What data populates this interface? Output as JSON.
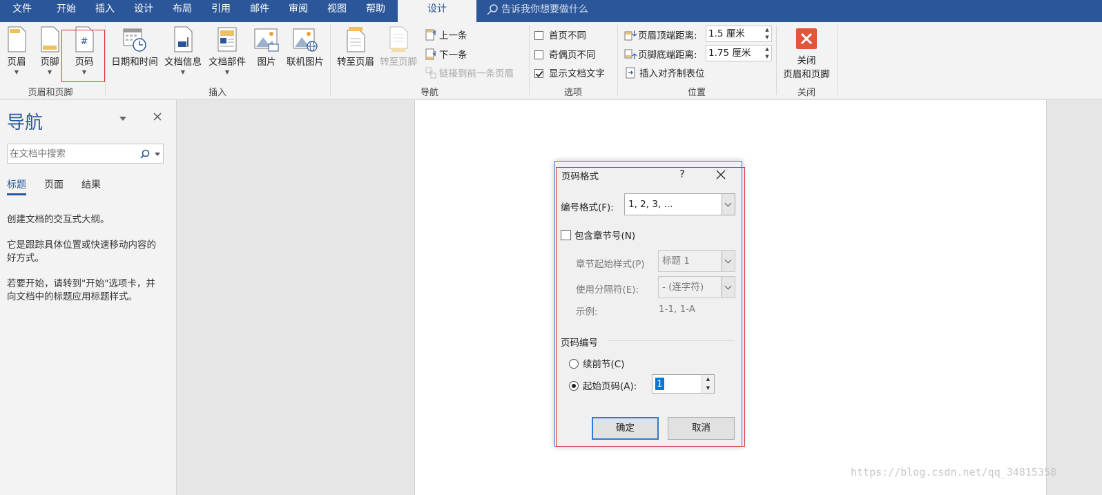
{
  "menubar": {
    "tabs": [
      "文件",
      "开始",
      "插入",
      "设计",
      "布局",
      "引用",
      "邮件",
      "审阅",
      "视图",
      "帮助"
    ],
    "active_tab": "设计",
    "tellme": "告诉我你想要做什么"
  },
  "ribbon": {
    "group_header_footer": {
      "label": "页眉和页脚",
      "header": "页眉",
      "footer": "页脚",
      "page_number": "页码",
      "page_number_icon": "#"
    },
    "group_insert": {
      "label": "插入",
      "datetime": "日期和时间",
      "docinfo": "文档信息",
      "quickparts": "文档部件",
      "picture": "图片",
      "online_picture": "联机图片"
    },
    "group_nav": {
      "label": "导航",
      "goto_header": "转至页眉",
      "goto_footer": "转至页脚",
      "previous": "上一条",
      "next": "下一条",
      "link_previous": "链接到前一条页眉"
    },
    "group_options": {
      "label": "选项",
      "diff_first": "首页不同",
      "diff_odd_even": "奇偶页不同",
      "show_doc_text": "显示文档文字"
    },
    "group_position": {
      "label": "位置",
      "header_top_label": "页眉顶端距离:",
      "header_top_value": "1.5 厘米",
      "footer_bottom_label": "页脚底端距离:",
      "footer_bottom_value": "1.75 厘米",
      "insert_align_tab": "插入对齐制表位"
    },
    "group_close": {
      "label": "关闭",
      "close_line1": "关闭",
      "close_line2": "页眉和页脚"
    }
  },
  "nav": {
    "title": "导航",
    "search_placeholder": "在文档中搜索",
    "tabs": [
      "标题",
      "页面",
      "结果"
    ],
    "text1": "创建文档的交互式大纲。",
    "text2": "它是跟踪具体位置或快速移动内容的好方式。",
    "text3": "若要开始，请转到\"开始\"选项卡，并向文档中的标题应用标题样式。"
  },
  "dialog": {
    "title": "页码格式",
    "help": "?",
    "number_format_label": "编号格式(F):",
    "number_format_value": "1, 2, 3, ...",
    "include_chapter": "包含章节号(N)",
    "chapter_style_label": "章节起始样式(P)",
    "chapter_style_value": "标题 1",
    "separator_label": "使用分隔符(E):",
    "separator_value": "-  (连字符)",
    "example_label": "示例:",
    "example_value": "1-1, 1-A",
    "numbering_label": "页码编号",
    "continue_prev": "续前节(C)",
    "start_at": "起始页码(A):",
    "start_at_value": "1",
    "ok": "确定",
    "cancel": "取消"
  },
  "watermark": "https://blog.csdn.net/qq_34815358",
  "colors": {
    "accent": "#2b579a",
    "highlight_red": "#e03030",
    "close_red": "#e2563b"
  }
}
